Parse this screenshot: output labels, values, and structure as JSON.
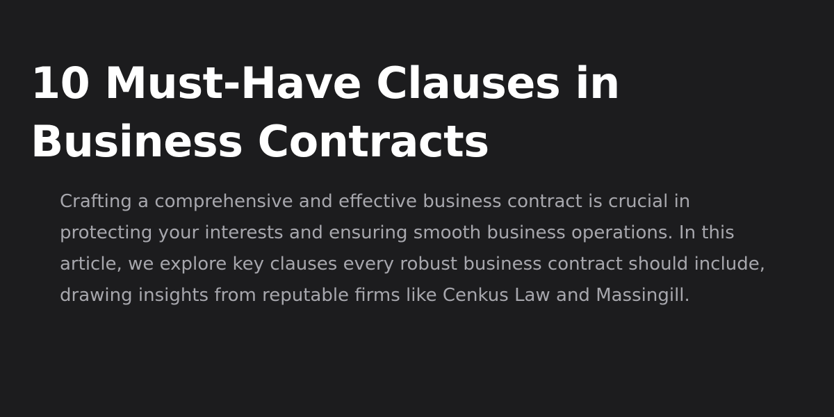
{
  "article": {
    "title": "10 Must-Have Clauses in Business Contracts",
    "excerpt": "Crafting a comprehensive and effective business contract is crucial in protecting your interests and ensuring smooth business operations. In this article, we explore key clauses every robust business contract should include, drawing insights from reputable firms like Cenkus Law and Massingill."
  },
  "colors": {
    "background": "#1c1c1e",
    "title": "#ffffff",
    "excerpt": "#a7a7ad"
  }
}
